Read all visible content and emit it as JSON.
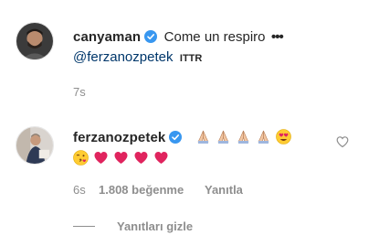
{
  "post": {
    "username": "canyaman",
    "caption": "Come un respiro",
    "more": "•••",
    "mention": "@ferzanozpetek",
    "translate": "ITTR",
    "time": "7s"
  },
  "comment": {
    "username": "ferzanozpetek",
    "emoji_line1": [
      "folded-hands",
      "folded-hands",
      "folded-hands",
      "folded-hands",
      "heart-eyes"
    ],
    "emoji_line2": [
      "kissing-face",
      "red-heart",
      "red-heart",
      "red-heart",
      "red-heart"
    ],
    "time": "6s",
    "likes": "1.808 beğenme",
    "reply": "Yanıtla",
    "hide_replies": "Yanıtları gizle"
  },
  "colors": {
    "verified": "#3897f0",
    "text": "#262626",
    "muted": "#8e8e8e",
    "mention": "#00376b"
  }
}
